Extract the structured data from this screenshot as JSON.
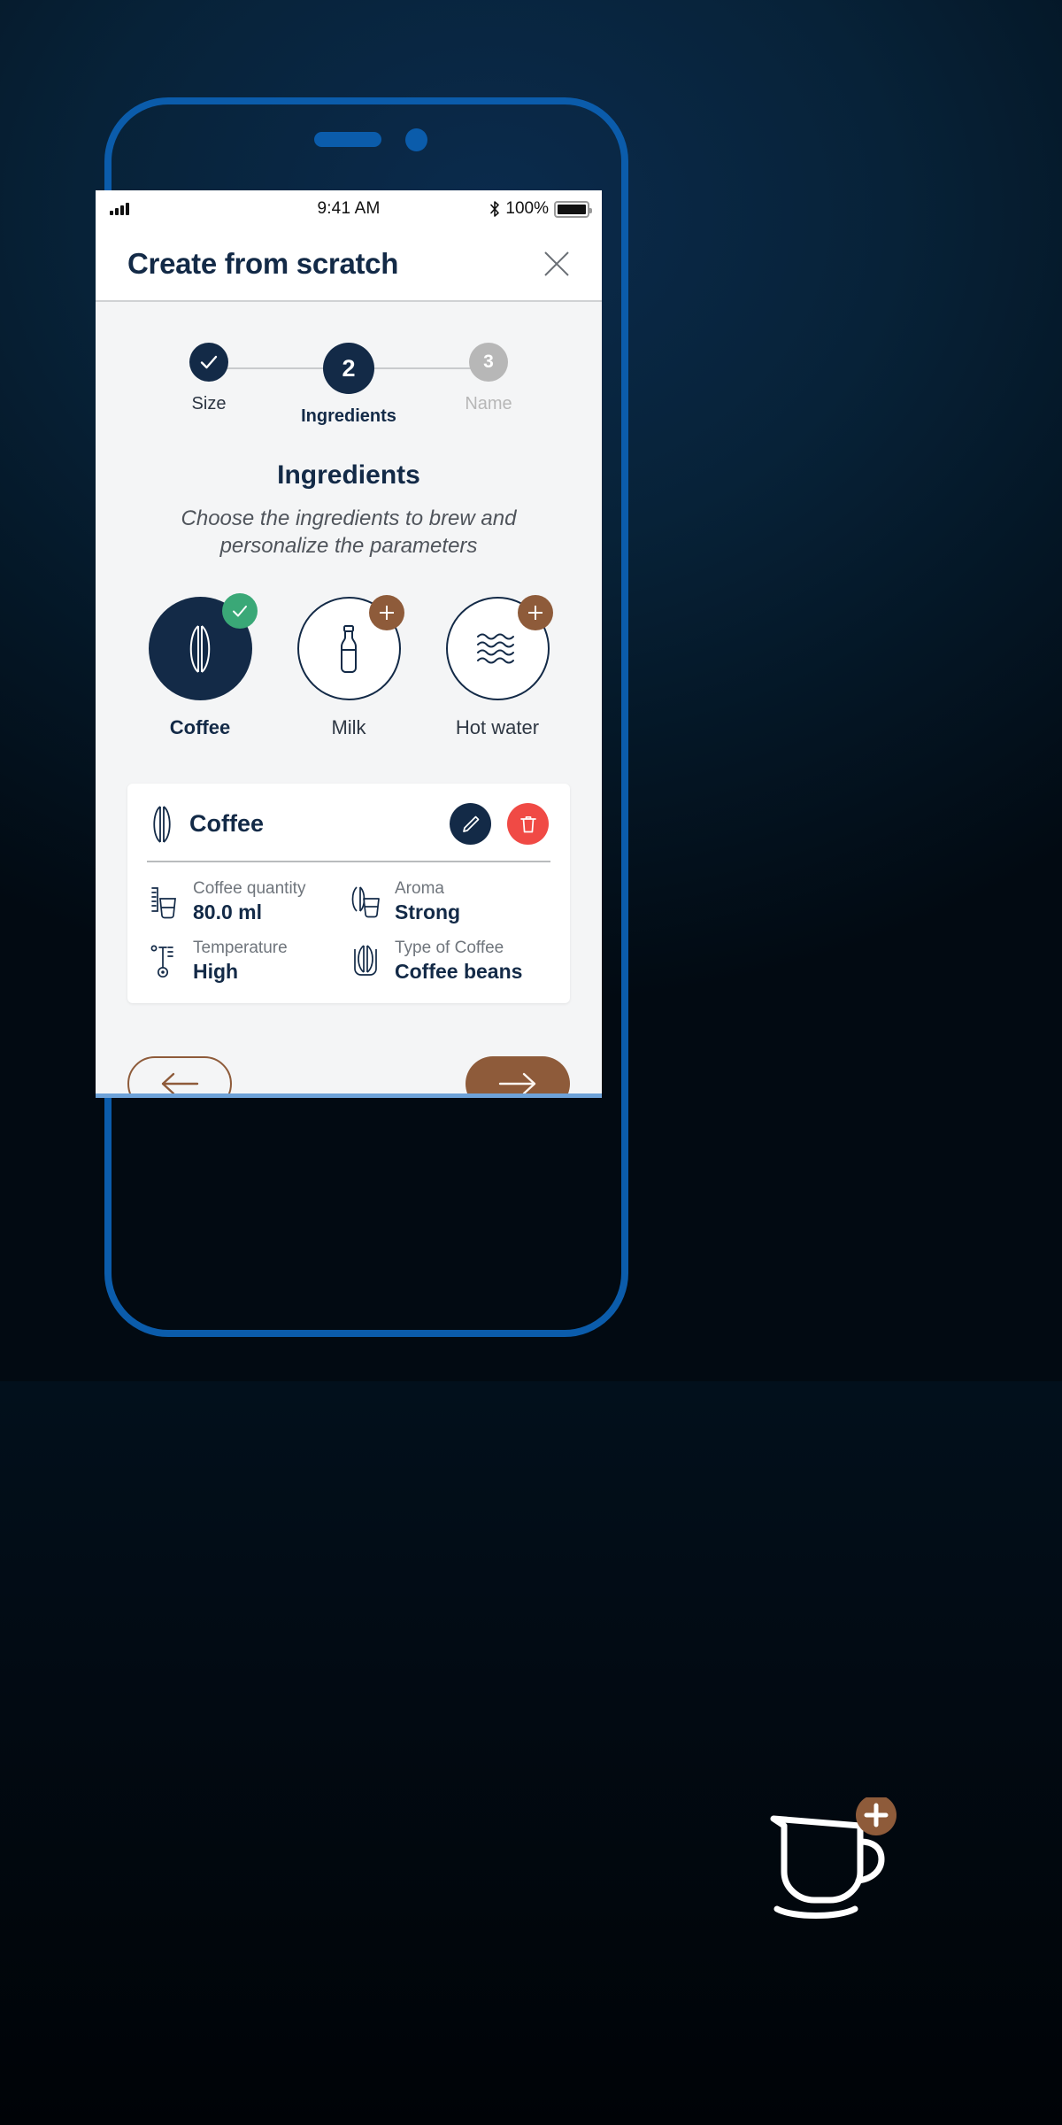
{
  "status_bar": {
    "signal_icon": "cellular-signal-icon",
    "time": "9:41 AM",
    "bluetooth_icon": "bluetooth-icon",
    "battery_percent": "100%",
    "battery_icon": "battery-full-icon"
  },
  "header": {
    "title": "Create from scratch",
    "close_icon": "close-icon"
  },
  "stepper": {
    "steps": [
      {
        "indicator": "✓",
        "label": "Size",
        "state": "done"
      },
      {
        "indicator": "2",
        "label": "Ingredients",
        "state": "active"
      },
      {
        "indicator": "3",
        "label": "Name",
        "state": "todo"
      }
    ]
  },
  "section": {
    "title": "Ingredients",
    "subtitle": "Choose the ingredients to brew and personalize the parameters"
  },
  "ingredients": [
    {
      "label": "Coffee",
      "icon": "coffee-bean-icon",
      "selected": true,
      "badge": "check"
    },
    {
      "label": "Milk",
      "icon": "milk-bottle-icon",
      "selected": false,
      "badge": "plus"
    },
    {
      "label": "Hot water",
      "icon": "water-waves-icon",
      "selected": false,
      "badge": "plus"
    }
  ],
  "detail_card": {
    "title": "Coffee",
    "title_icon": "coffee-bean-icon",
    "edit_icon": "pencil-icon",
    "delete_icon": "trash-icon",
    "params": [
      {
        "label": "Coffee quantity",
        "value": "80.0 ml",
        "icon": "measuring-cup-icon"
      },
      {
        "label": "Aroma",
        "value": "Strong",
        "icon": "aroma-bean-cup-icon"
      },
      {
        "label": "Temperature",
        "value": "High",
        "icon": "thermometer-icon"
      },
      {
        "label": "Type of Coffee",
        "value": "Coffee beans",
        "icon": "coffee-beans-container-icon"
      }
    ]
  },
  "navigation": {
    "back_icon": "arrow-left-icon",
    "next_icon": "arrow-right-icon"
  },
  "brand_logo": {
    "icon": "coffee-cup-plus-icon"
  },
  "colors": {
    "navy": "#132a47",
    "brown": "#8e5b3a",
    "green": "#3aa877",
    "red": "#f04a45",
    "frame_blue": "#0b5cab",
    "gray": "#b7b7b7"
  }
}
